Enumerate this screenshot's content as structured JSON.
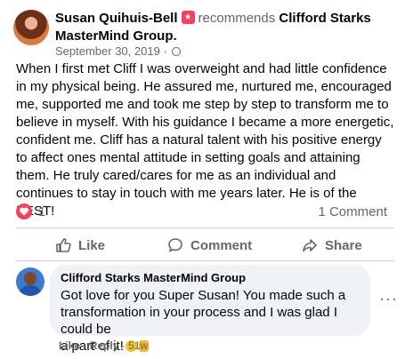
{
  "post": {
    "author": "Susan Quihuis-Bell",
    "verb": "recommends",
    "target_line1": "Clifford Starks",
    "target_line2": "MasterMind Group.",
    "date": "September 30, 2019",
    "separator": "·",
    "body": "When I first met Cliff I was overweight and had little confidence in my physical being. He assured me, nurtured me, encouraged me, supported me and took me step by step to transform me to believe in myself. With his guidance I became a more energetic, confident me. Cliff has a natural talent with his positive energy to affect ones mental attitude in setting goals and attaining them. He truly cared/cares for me as an individual and continues to stay in touch with me years later. He is of the BEST!",
    "reaction_count": "1",
    "comment_count": "1 Comment"
  },
  "actions": {
    "like": "Like",
    "comment": "Comment",
    "share": "Share"
  },
  "comment": {
    "author": "Clifford Starks MasterMind Group",
    "text_line1": "Got love for you Super Susan! You made such a",
    "text_line2": "transformation in your process and I was glad I could be",
    "text_line3": "a part of it!",
    "more": "···",
    "like": "Like",
    "reply": "Reply",
    "time": "51w",
    "sep": "·"
  },
  "colors": {
    "accent_red": "#f3425f",
    "muted": "#65676b",
    "bubble": "#f0f2f5"
  }
}
